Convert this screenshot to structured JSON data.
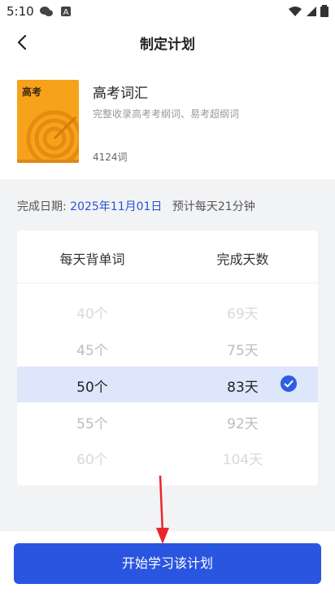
{
  "status": {
    "time": "5:10"
  },
  "header": {
    "title": "制定计划"
  },
  "book": {
    "cover_text": "高考",
    "name": "高考词汇",
    "description": "完整收录高考考纲词、易考超纲词",
    "word_count": "4124词"
  },
  "plan": {
    "date_label": "完成日期:",
    "date_value": "2025年11月01日",
    "estimate": "预计每天21分钟"
  },
  "picker": {
    "col1_header": "每天背单词",
    "col2_header": "完成天数",
    "rows": [
      {
        "words": "40个",
        "days": "69天"
      },
      {
        "words": "45个",
        "days": "75天"
      },
      {
        "words": "50个",
        "days": "83天",
        "selected": true
      },
      {
        "words": "55个",
        "days": "92天"
      },
      {
        "words": "60个",
        "days": "104天"
      }
    ]
  },
  "footer": {
    "start_button": "开始学习该计划"
  },
  "colors": {
    "accent": "#2a55e0",
    "selected_row": "#dde6fa",
    "cover": "#f7a21b",
    "annotation_arrow": "#e8262c"
  }
}
